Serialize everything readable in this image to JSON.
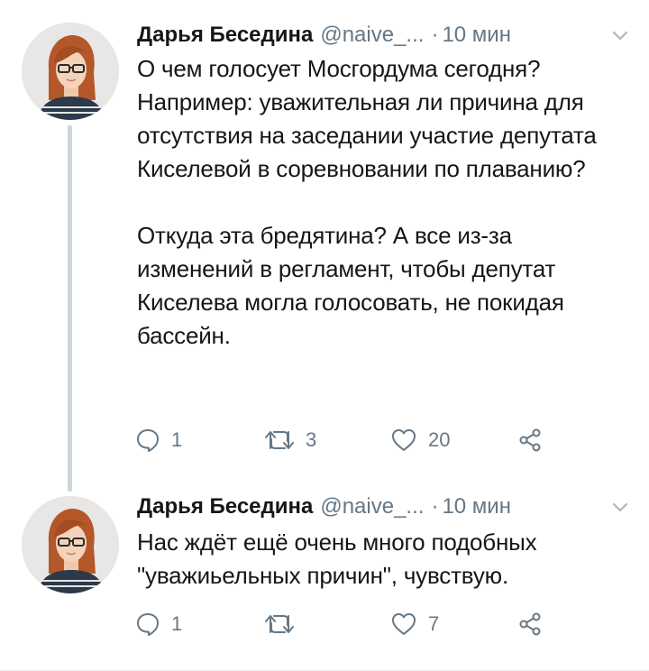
{
  "tweets": [
    {
      "author_name": "Дарья Беседина",
      "handle": "@naive_...",
      "separator": "·",
      "time": "10 мин",
      "avatar_icon": "avatar-woman-red-hair-glasses",
      "text_paragraphs": [
        "О чем голосует Мосгордума сегодня? Например: уважительная ли причина для отсутствия на заседании участие депутата Киселевой в соревновании по плаванию?",
        "Откуда эта бредятина? А все из-за изменений в регламент, чтобы депутат Киселева могла голосовать, не покидая бассейн."
      ],
      "replies": "1",
      "retweets": "3",
      "likes": "20"
    },
    {
      "author_name": "Дарья Беседина",
      "handle": "@naive_...",
      "separator": "·",
      "time": "10 мин",
      "avatar_icon": "avatar-woman-red-hair-glasses",
      "text_paragraphs": [
        "Нас ждёт ещё очень много подобных \"уважиьельных причин\", чувствую."
      ],
      "replies": "1",
      "retweets": "",
      "likes": "7"
    }
  ],
  "colors": {
    "text": "#14171a",
    "muted": "#657786",
    "thread_line": "#ccd6dd",
    "background": "#ffffff"
  },
  "icons": [
    "reply-icon",
    "retweet-icon",
    "like-icon",
    "share-icon",
    "chevron-down-icon"
  ]
}
